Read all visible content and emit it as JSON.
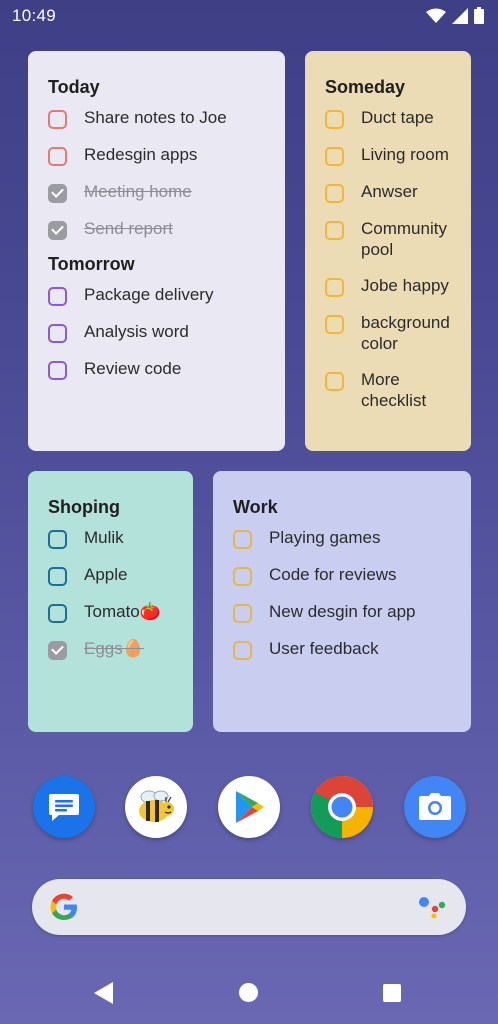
{
  "status_bar": {
    "time": "10:49",
    "icons": [
      "wifi-icon",
      "signal-icon",
      "battery-icon"
    ]
  },
  "today_widget": {
    "sections": [
      {
        "title": "Today",
        "items": [
          {
            "text": "Share notes to Joe",
            "done": false
          },
          {
            "text": "Redesgin apps",
            "done": false
          },
          {
            "text": "Meeting  home",
            "done": true
          },
          {
            "text": "Send report",
            "done": true
          }
        ]
      },
      {
        "title": "Tomorrow",
        "items": [
          {
            "text": "Package delivery",
            "done": false
          },
          {
            "text": "Analysis word",
            "done": false
          },
          {
            "text": "Review code",
            "done": false
          }
        ]
      }
    ]
  },
  "someday_widget": {
    "title": "Someday",
    "items": [
      {
        "text": "Duct tape",
        "done": false
      },
      {
        "text": "Living room",
        "done": false
      },
      {
        "text": "Anwser",
        "done": false
      },
      {
        "text": "Community pool",
        "done": false
      },
      {
        "text": "Jobe happy",
        "done": false
      },
      {
        "text": "background color",
        "done": false
      },
      {
        "text": "More checklist",
        "done": false
      }
    ]
  },
  "shopping_widget": {
    "title": "Shoping",
    "items": [
      {
        "text": "Mulik",
        "done": false
      },
      {
        "text": "Apple",
        "done": false
      },
      {
        "text": "Tomato🍅",
        "done": false
      },
      {
        "text": "Eggs🥚",
        "done": true
      }
    ]
  },
  "work_widget": {
    "title": "Work",
    "items": [
      {
        "text": "Playing games",
        "done": false
      },
      {
        "text": "Code for reviews",
        "done": false
      },
      {
        "text": "New desgin for app",
        "done": false
      },
      {
        "text": "User feedback",
        "done": false
      }
    ]
  },
  "dock": {
    "apps": [
      "messages-icon",
      "bee-app-icon",
      "play-store-icon",
      "chrome-icon",
      "camera-icon"
    ]
  },
  "search_bar": {
    "icons": [
      "google-logo-icon",
      "assistant-icon"
    ]
  },
  "nav_bar": {
    "icons": [
      "back-icon",
      "home-icon",
      "recents-icon"
    ]
  },
  "colors": {
    "today_bg": "#eae8f2",
    "someday_bg": "#ecdcb5",
    "shopping_bg": "#b3e2da",
    "work_bg": "#c9cdf0",
    "today_checkbox": "#e57a6e",
    "tomorrow_checkbox": "#8a5ad8",
    "someday_checkbox": "#f4b636",
    "shopping_checkbox": "#1a6f9a",
    "work_checkbox": "#e3b84a"
  }
}
